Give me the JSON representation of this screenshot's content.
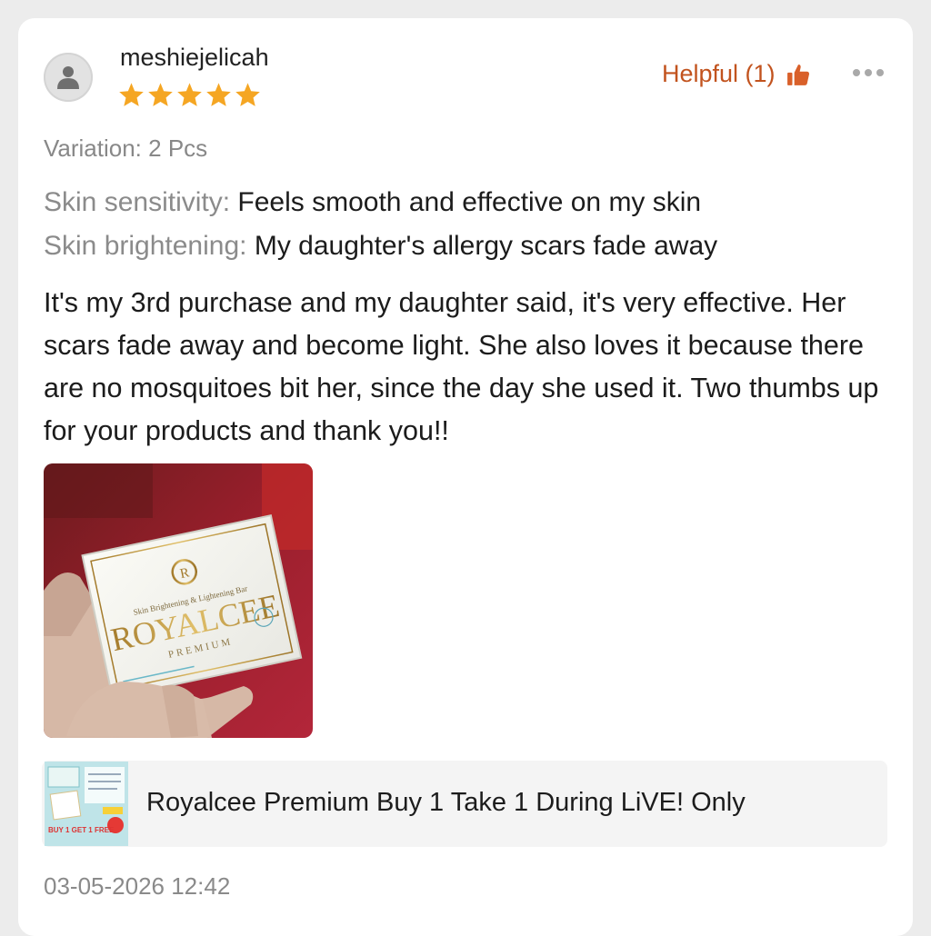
{
  "review": {
    "username": "meshiejelicah",
    "rating": 5,
    "rating_max": 5,
    "helpful_label": "Helpful (1)",
    "variation": "Variation: 2 Pcs",
    "attributes": [
      {
        "label": "Skin sensitivity:",
        "value": "Feels smooth and effective on my skin"
      },
      {
        "label": "Skin brightening:",
        "value": "My daughter's allergy scars fade away"
      }
    ],
    "body": "It's my 3rd purchase and my daughter said, it's very effective. Her scars fade away and become light. She also loves it because there are no mosquitoes bit her, since the day she used it. Two thumbs up for your products and thank you!!",
    "timestamp": "03-05-2026 12:42"
  },
  "photo": {
    "box_tagline": "Skin Brightening & Lightening Bar",
    "box_brand": "ROYALCEE",
    "box_sub": "PREMIUM",
    "box_monogram": "R"
  },
  "product": {
    "title": "Royalcee Premium Buy 1 Take 1 During LiVE! Only",
    "thumb_text": "BUY 1 GET 1 FREE"
  },
  "icons": {
    "avatar": "user-icon",
    "stars": "star-icon",
    "helpful": "thumbs-up-icon",
    "more": "more-horizontal-icon"
  },
  "colors": {
    "star": "#f5a623",
    "helpful": "#c2531e",
    "muted": "#888888"
  }
}
